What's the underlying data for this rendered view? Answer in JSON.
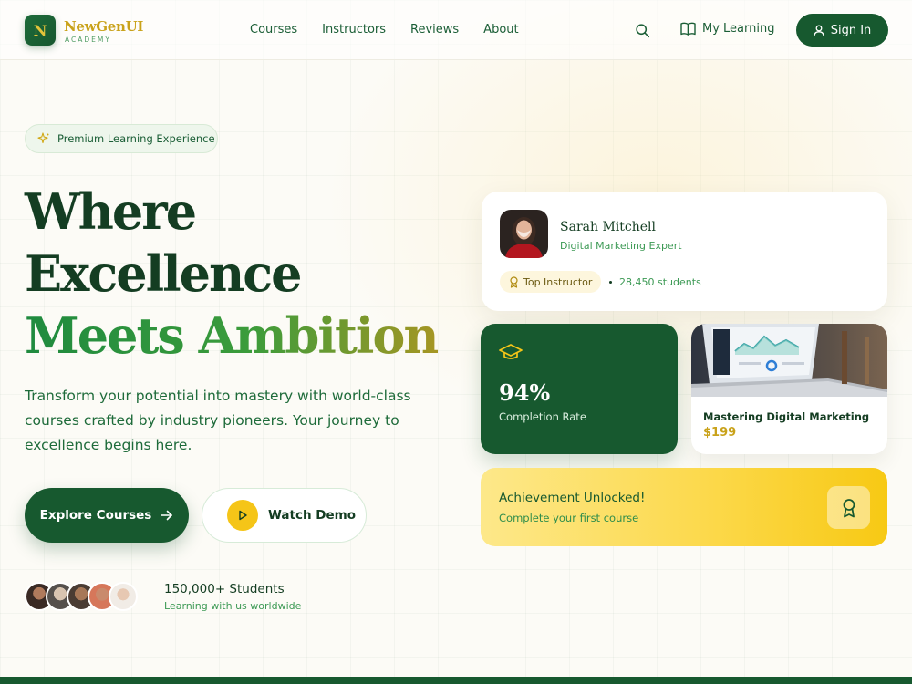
{
  "nav": {
    "logo_letter": "N",
    "logo_name": "NewGenUI",
    "logo_sub": "ACADEMY",
    "links": [
      "Courses",
      "Instructors",
      "Reviews",
      "About"
    ],
    "my_learning": "My Learning",
    "sign_in": "Sign In"
  },
  "hero": {
    "badge": "Premium Learning Experience",
    "title_line1": "Where",
    "title_line2": "Excellence",
    "title_line3": "Meets Ambition",
    "description": "Transform your potential into mastery with world-class courses crafted by industry pioneers. Your journey to excellence begins here.",
    "explore_button": "Explore Courses",
    "demo_button": "Watch Demo",
    "students_count": "150,000+ Students",
    "students_sub": "Learning with us worldwide"
  },
  "instructor": {
    "name": "Sarah Mitchell",
    "role": "Digital Marketing Expert",
    "tag": "Top Instructor",
    "students": "28,450 students"
  },
  "completion": {
    "value": "94%",
    "label": "Completion Rate"
  },
  "course": {
    "title": "Mastering Digital Marketing",
    "price": "$199"
  },
  "achievement": {
    "title": "Achievement Unlocked!",
    "subtitle": "Complete your first course"
  },
  "colors": {
    "primary": "#17592f",
    "accent": "#f5c518",
    "gold": "#c9a21a",
    "text_green": "#3d9a55"
  },
  "icons": [
    "search-icon",
    "book-icon",
    "user-icon",
    "sparkle-icon",
    "arrow-right-icon",
    "play-icon",
    "award-icon",
    "graduation-cap-icon",
    "medal-icon"
  ]
}
